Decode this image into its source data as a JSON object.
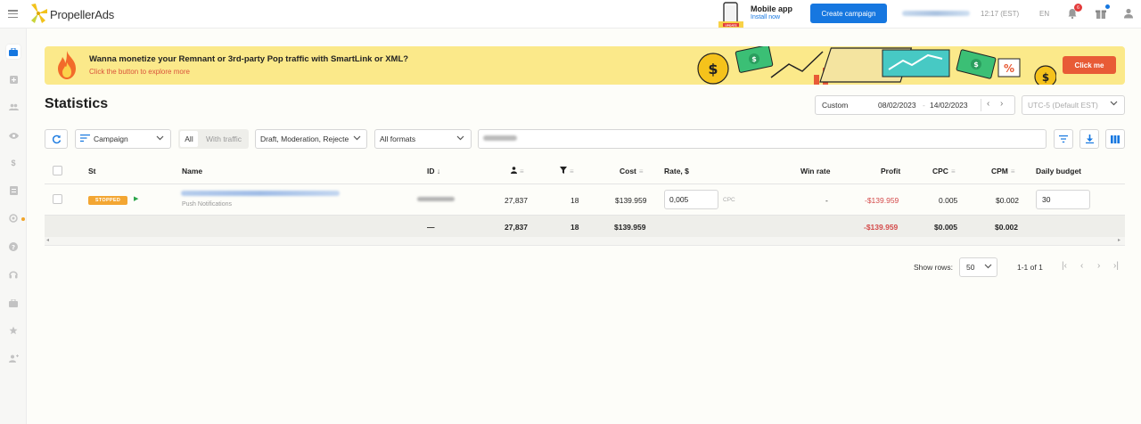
{
  "app": {
    "brand": "PropellerAds"
  },
  "header": {
    "mobile_app_title": "Mobile app",
    "mobile_app_link": "Install now",
    "mobile_app_badge": "UPDATE",
    "create_campaign": "Create campaign",
    "time": "12:17 (EST)",
    "language": "EN",
    "notifications_count": "6"
  },
  "banner": {
    "title": "Wanna monetize your Remnant or 3rd-party Pop traffic with SmartLink or XML?",
    "subtitle": "Click the button to explore more",
    "cta": "Click me"
  },
  "page": {
    "title": "Statistics"
  },
  "date_range": {
    "preset": "Custom",
    "from": "08/02/2023",
    "to": "14/02/2023",
    "separator": "-",
    "timezone": "UTC-5 (Default EST)"
  },
  "filters": {
    "group_by": "Campaign",
    "traffic_all": "All",
    "traffic_with": "With traffic",
    "status": "Draft, Moderation, Rejecte",
    "formats": "All formats"
  },
  "table": {
    "headers": {
      "status": "St",
      "name": "Name",
      "id": "ID",
      "cost": "Cost",
      "rate": "Rate, $",
      "win_rate": "Win rate",
      "profit": "Profit",
      "cpc": "CPC",
      "cpm": "CPM",
      "daily_budget": "Daily budget"
    },
    "row": {
      "status": "STOPPED",
      "subtitle": "Push Notifications",
      "impressions": "27,837",
      "clicks": "18",
      "cost": "$139.959",
      "rate": "0,005",
      "rate_unit": "CPC",
      "win_rate": "-",
      "profit": "-$139.959",
      "cpc": "0.005",
      "cpm": "$0.002",
      "daily_budget": "30"
    },
    "totals": {
      "id": "—",
      "impressions": "27,837",
      "clicks": "18",
      "cost": "$139.959",
      "profit": "-$139.959",
      "cpc": "$0.005",
      "cpm": "$0.002"
    }
  },
  "pagination": {
    "show_rows_label": "Show rows:",
    "rows": "50",
    "range": "1-1 of 1"
  },
  "colors": {
    "accent": "#1677e0",
    "banner_bg": "#fbe98a",
    "cta": "#e85b36",
    "stopped": "#f3a632",
    "negative": "#d44a4a"
  }
}
